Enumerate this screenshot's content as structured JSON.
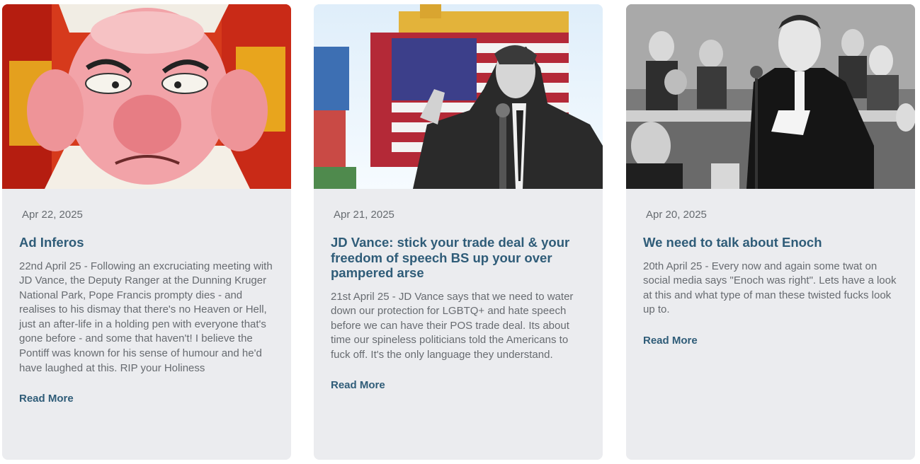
{
  "posts": [
    {
      "image": "cartoon-pope-image",
      "date": "Apr 22, 2025",
      "title": "Ad Inferos",
      "excerpt": "22nd April 25 - Following an excruciating meeting with JD Vance, the Deputy Ranger at the Dunning Kruger National Park, Pope Francis prompty dies - and realises to his dismay that there's no Heaven or Hell, just an after-life in a holding pen with everyone that's gone before - and some that haven't! I believe the Pontiff was known for his sense of humour and he'd have laughed at this. RIP your Holiness",
      "read_more": "Read More"
    },
    {
      "image": "flag-container-speaker-image",
      "date": "Apr 21, 2025",
      "title": "JD Vance: stick your trade deal & your freedom of speech BS up your over pampered arse",
      "excerpt": "21st April 25 - JD Vance says that we need to water down our protection for LGBTQ+ and hate speech before we can have their POS trade deal. Its about time our spineless politicians told the Americans to fuck off. It's the only language they understand.",
      "read_more": "Read More"
    },
    {
      "image": "black-and-white-speech-image",
      "date": "Apr 20, 2025",
      "title": "We need to talk about Enoch",
      "excerpt": "20th April 25 - Every now and again some twat on social media says \"Enoch was right\". Lets have a look at this and what type of man these twisted fucks look up to.",
      "read_more": "Read More"
    }
  ],
  "colors": {
    "card_bg": "#ebecef",
    "title": "#2f5c78",
    "text": "#676b70"
  }
}
